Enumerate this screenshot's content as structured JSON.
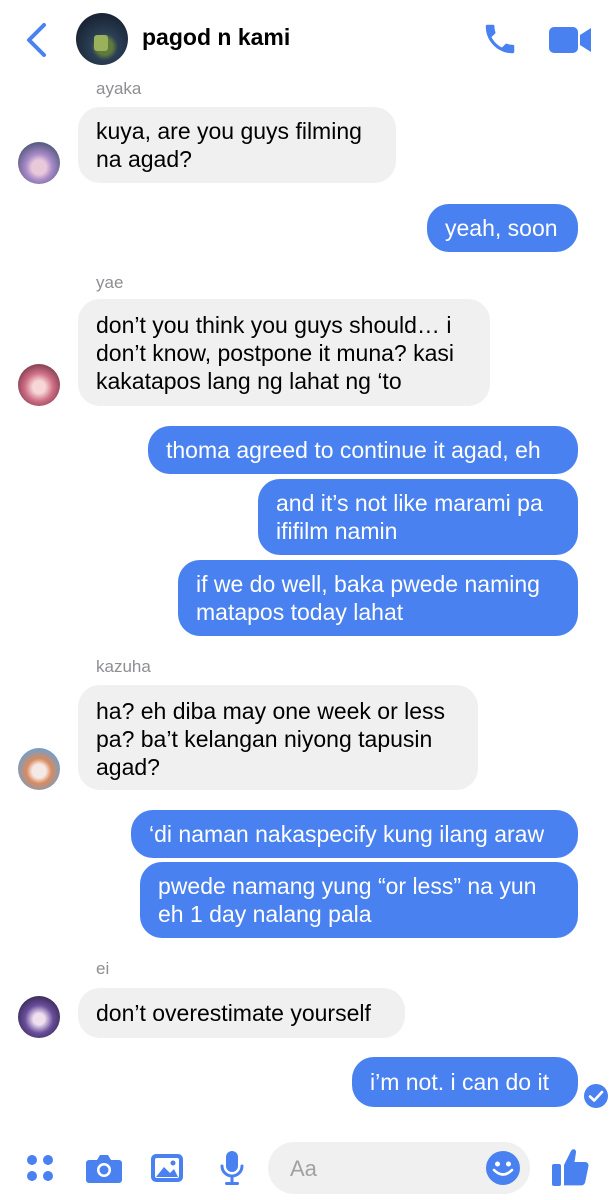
{
  "header": {
    "title": "pagod n kami"
  },
  "messages": [
    {
      "sender": "ayaka",
      "text_lines": [
        "kuya, are you guys filming",
        "na agad?"
      ]
    },
    {
      "outgoing": true,
      "text_lines": [
        "yeah, soon"
      ]
    },
    {
      "sender": "yae",
      "text_lines": [
        "don’t you think you guys should… i",
        "don’t know, postpone it muna? kasi",
        "kakatapos lang ng lahat ng ‘to"
      ]
    },
    {
      "outgoing": true,
      "text_lines": [
        "thoma agreed to continue it agad, eh"
      ]
    },
    {
      "outgoing": true,
      "text_lines": [
        "and it’s not like marami pa",
        "ififilm namin"
      ]
    },
    {
      "outgoing": true,
      "text_lines": [
        "if we do well, baka pwede naming",
        "matapos today lahat"
      ]
    },
    {
      "sender": "kazuha",
      "text_lines": [
        "ha? eh diba may one week or less",
        "pa? ba’t kelangan niyong tapusin",
        "agad?"
      ]
    },
    {
      "outgoing": true,
      "text_lines": [
        "‘di naman nakaspecify kung ilang araw"
      ]
    },
    {
      "outgoing": true,
      "text_lines": [
        "pwede namang yung “or less” na yun",
        "eh 1 day nalang pala"
      ]
    },
    {
      "sender": "ei",
      "text_lines": [
        "don’t overestimate yourself"
      ]
    },
    {
      "outgoing": true,
      "text_lines": [
        "i’m not. i can do it"
      ]
    }
  ],
  "composer": {
    "placeholder": "Aa"
  },
  "colors": {
    "accent": "#4a81f0",
    "incoming_bubble": "#f0f0f0",
    "sender_label": "#8e8e93"
  },
  "icons": [
    "back-chevron-icon",
    "phone-icon",
    "video-camera-icon",
    "apps-grid-icon",
    "camera-icon",
    "gallery-icon",
    "microphone-icon",
    "emoji-icon",
    "thumbs-up-icon",
    "seen-check-icon"
  ]
}
